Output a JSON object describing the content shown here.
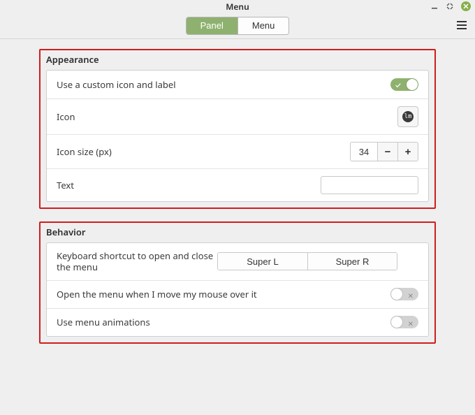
{
  "window": {
    "title": "Menu"
  },
  "tabs": {
    "panel": "Panel",
    "menu": "Menu",
    "active": "panel"
  },
  "appearance": {
    "title": "Appearance",
    "custom_icon_label": "Use a custom icon and label",
    "custom_icon_on": true,
    "icon_label": "Icon",
    "icon_size_label": "Icon size (px)",
    "icon_size_value": "34",
    "decrement_label": "−",
    "increment_label": "+",
    "text_label": "Text",
    "text_value": ""
  },
  "behavior": {
    "title": "Behavior",
    "shortcut_label": "Keyboard shortcut to open and close the menu",
    "shortcut_1": "Super L",
    "shortcut_2": "Super R",
    "hover_label": "Open the menu when I move my mouse over it",
    "hover_on": false,
    "anim_label": "Use menu animations",
    "anim_on": false
  }
}
